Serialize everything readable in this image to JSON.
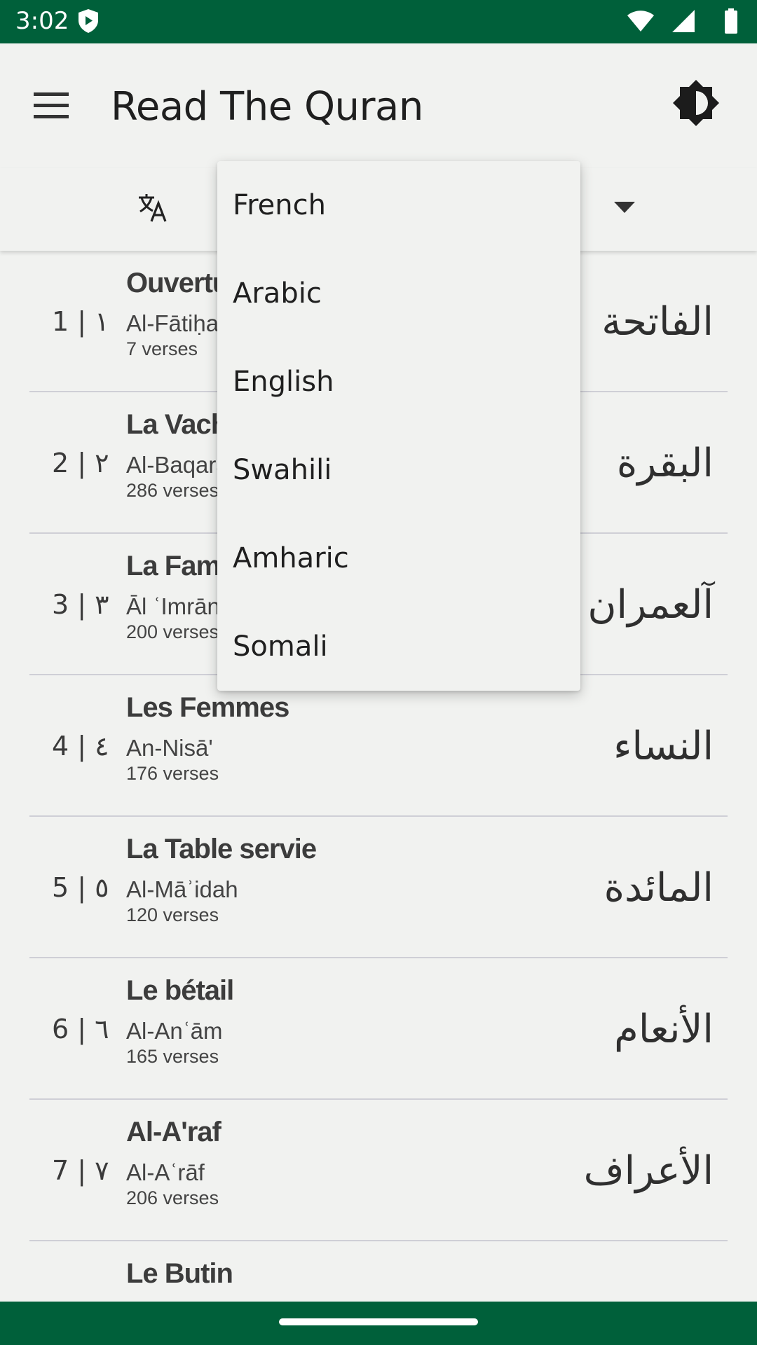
{
  "status_bar": {
    "time": "3:02",
    "icons": [
      "shield-play-icon",
      "wifi-icon",
      "signal-icon",
      "battery-icon"
    ]
  },
  "app_bar": {
    "title": "Read The Quran",
    "menu_icon": "menu-icon",
    "theme_icon": "brightness-icon"
  },
  "language_selector": {
    "icon": "translate-icon",
    "options": [
      "French",
      "Arabic",
      "English",
      "Swahili",
      "Amharic",
      "Somali"
    ]
  },
  "surahs": [
    {
      "number": "1 | ١",
      "name": "Ouverture",
      "translit": "Al-Fātiḥah",
      "verses": "7 verses",
      "arabic": "الفاتحة"
    },
    {
      "number": "2 | ٢",
      "name": "La Vache",
      "translit": "Al-Baqarah",
      "verses": "286 verses",
      "arabic": "البقرة"
    },
    {
      "number": "3 | ٣",
      "name": "La Famille d'Imran",
      "translit": "Āl ʿImrān",
      "verses": "200 verses",
      "arabic": "آلعمران"
    },
    {
      "number": "4 | ٤",
      "name": "Les Femmes",
      "translit": "An-Nisā'",
      "verses": "176 verses",
      "arabic": "النساء"
    },
    {
      "number": "5 | ٥",
      "name": "La Table servie",
      "translit": "Al-Māʾidah",
      "verses": "120 verses",
      "arabic": "المائدة"
    },
    {
      "number": "6 | ٦",
      "name": "Le bétail",
      "translit": "Al-Anʿām",
      "verses": "165 verses",
      "arabic": "الأنعام"
    },
    {
      "number": "7 | ٧",
      "name": "Al-A'raf",
      "translit": "Al-Aʿrāf",
      "verses": "206 verses",
      "arabic": "الأعراف"
    },
    {
      "number": "",
      "name": "Le Butin",
      "translit": "",
      "verses": "",
      "arabic": ""
    }
  ],
  "colors": {
    "primary": "#00603a",
    "background": "#f1f2f0",
    "divider": "#cfcfd6"
  }
}
